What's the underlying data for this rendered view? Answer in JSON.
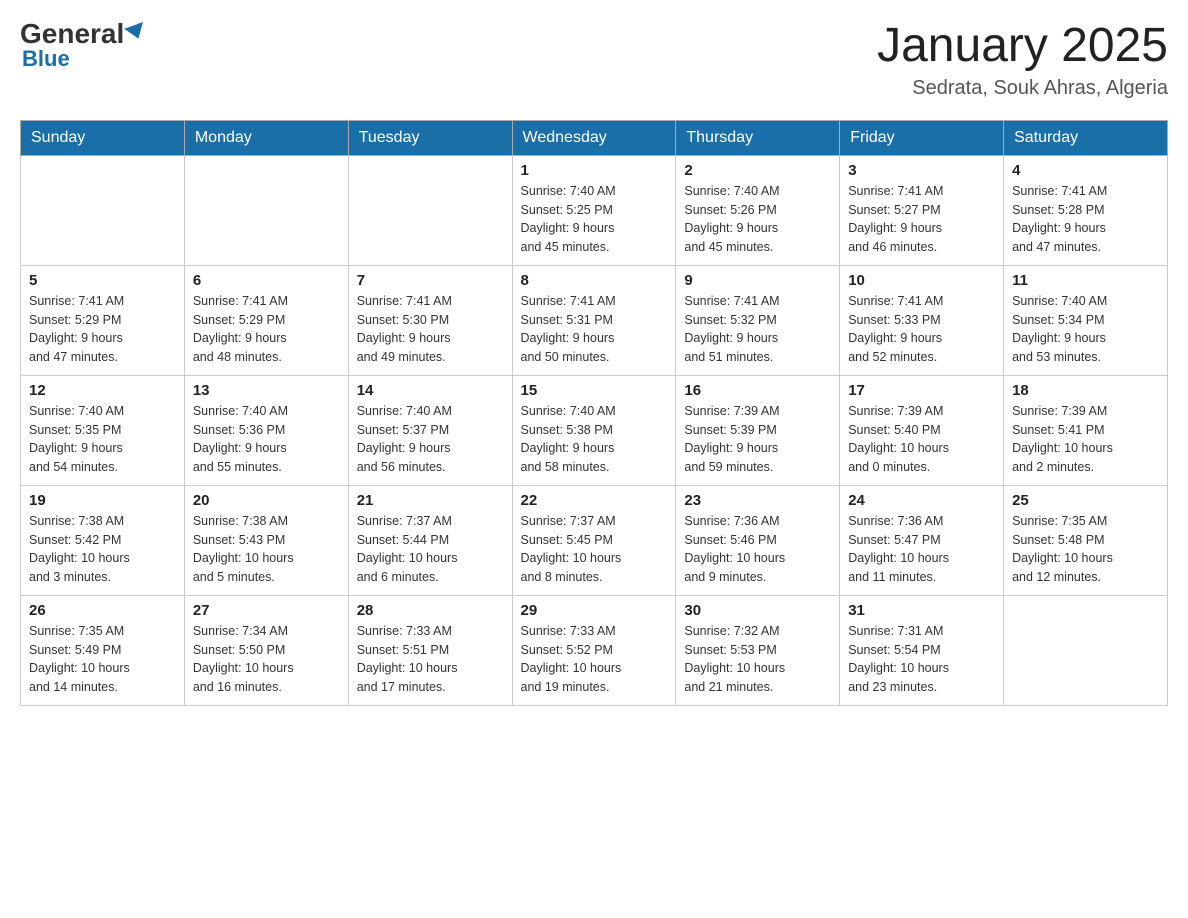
{
  "header": {
    "logo_general": "General",
    "logo_blue": "Blue",
    "month_title": "January 2025",
    "location": "Sedrata, Souk Ahras, Algeria"
  },
  "weekdays": [
    "Sunday",
    "Monday",
    "Tuesday",
    "Wednesday",
    "Thursday",
    "Friday",
    "Saturday"
  ],
  "weeks": [
    [
      {
        "day": "",
        "info": ""
      },
      {
        "day": "",
        "info": ""
      },
      {
        "day": "",
        "info": ""
      },
      {
        "day": "1",
        "info": "Sunrise: 7:40 AM\nSunset: 5:25 PM\nDaylight: 9 hours\nand 45 minutes."
      },
      {
        "day": "2",
        "info": "Sunrise: 7:40 AM\nSunset: 5:26 PM\nDaylight: 9 hours\nand 45 minutes."
      },
      {
        "day": "3",
        "info": "Sunrise: 7:41 AM\nSunset: 5:27 PM\nDaylight: 9 hours\nand 46 minutes."
      },
      {
        "day": "4",
        "info": "Sunrise: 7:41 AM\nSunset: 5:28 PM\nDaylight: 9 hours\nand 47 minutes."
      }
    ],
    [
      {
        "day": "5",
        "info": "Sunrise: 7:41 AM\nSunset: 5:29 PM\nDaylight: 9 hours\nand 47 minutes."
      },
      {
        "day": "6",
        "info": "Sunrise: 7:41 AM\nSunset: 5:29 PM\nDaylight: 9 hours\nand 48 minutes."
      },
      {
        "day": "7",
        "info": "Sunrise: 7:41 AM\nSunset: 5:30 PM\nDaylight: 9 hours\nand 49 minutes."
      },
      {
        "day": "8",
        "info": "Sunrise: 7:41 AM\nSunset: 5:31 PM\nDaylight: 9 hours\nand 50 minutes."
      },
      {
        "day": "9",
        "info": "Sunrise: 7:41 AM\nSunset: 5:32 PM\nDaylight: 9 hours\nand 51 minutes."
      },
      {
        "day": "10",
        "info": "Sunrise: 7:41 AM\nSunset: 5:33 PM\nDaylight: 9 hours\nand 52 minutes."
      },
      {
        "day": "11",
        "info": "Sunrise: 7:40 AM\nSunset: 5:34 PM\nDaylight: 9 hours\nand 53 minutes."
      }
    ],
    [
      {
        "day": "12",
        "info": "Sunrise: 7:40 AM\nSunset: 5:35 PM\nDaylight: 9 hours\nand 54 minutes."
      },
      {
        "day": "13",
        "info": "Sunrise: 7:40 AM\nSunset: 5:36 PM\nDaylight: 9 hours\nand 55 minutes."
      },
      {
        "day": "14",
        "info": "Sunrise: 7:40 AM\nSunset: 5:37 PM\nDaylight: 9 hours\nand 56 minutes."
      },
      {
        "day": "15",
        "info": "Sunrise: 7:40 AM\nSunset: 5:38 PM\nDaylight: 9 hours\nand 58 minutes."
      },
      {
        "day": "16",
        "info": "Sunrise: 7:39 AM\nSunset: 5:39 PM\nDaylight: 9 hours\nand 59 minutes."
      },
      {
        "day": "17",
        "info": "Sunrise: 7:39 AM\nSunset: 5:40 PM\nDaylight: 10 hours\nand 0 minutes."
      },
      {
        "day": "18",
        "info": "Sunrise: 7:39 AM\nSunset: 5:41 PM\nDaylight: 10 hours\nand 2 minutes."
      }
    ],
    [
      {
        "day": "19",
        "info": "Sunrise: 7:38 AM\nSunset: 5:42 PM\nDaylight: 10 hours\nand 3 minutes."
      },
      {
        "day": "20",
        "info": "Sunrise: 7:38 AM\nSunset: 5:43 PM\nDaylight: 10 hours\nand 5 minutes."
      },
      {
        "day": "21",
        "info": "Sunrise: 7:37 AM\nSunset: 5:44 PM\nDaylight: 10 hours\nand 6 minutes."
      },
      {
        "day": "22",
        "info": "Sunrise: 7:37 AM\nSunset: 5:45 PM\nDaylight: 10 hours\nand 8 minutes."
      },
      {
        "day": "23",
        "info": "Sunrise: 7:36 AM\nSunset: 5:46 PM\nDaylight: 10 hours\nand 9 minutes."
      },
      {
        "day": "24",
        "info": "Sunrise: 7:36 AM\nSunset: 5:47 PM\nDaylight: 10 hours\nand 11 minutes."
      },
      {
        "day": "25",
        "info": "Sunrise: 7:35 AM\nSunset: 5:48 PM\nDaylight: 10 hours\nand 12 minutes."
      }
    ],
    [
      {
        "day": "26",
        "info": "Sunrise: 7:35 AM\nSunset: 5:49 PM\nDaylight: 10 hours\nand 14 minutes."
      },
      {
        "day": "27",
        "info": "Sunrise: 7:34 AM\nSunset: 5:50 PM\nDaylight: 10 hours\nand 16 minutes."
      },
      {
        "day": "28",
        "info": "Sunrise: 7:33 AM\nSunset: 5:51 PM\nDaylight: 10 hours\nand 17 minutes."
      },
      {
        "day": "29",
        "info": "Sunrise: 7:33 AM\nSunset: 5:52 PM\nDaylight: 10 hours\nand 19 minutes."
      },
      {
        "day": "30",
        "info": "Sunrise: 7:32 AM\nSunset: 5:53 PM\nDaylight: 10 hours\nand 21 minutes."
      },
      {
        "day": "31",
        "info": "Sunrise: 7:31 AM\nSunset: 5:54 PM\nDaylight: 10 hours\nand 23 minutes."
      },
      {
        "day": "",
        "info": ""
      }
    ]
  ]
}
